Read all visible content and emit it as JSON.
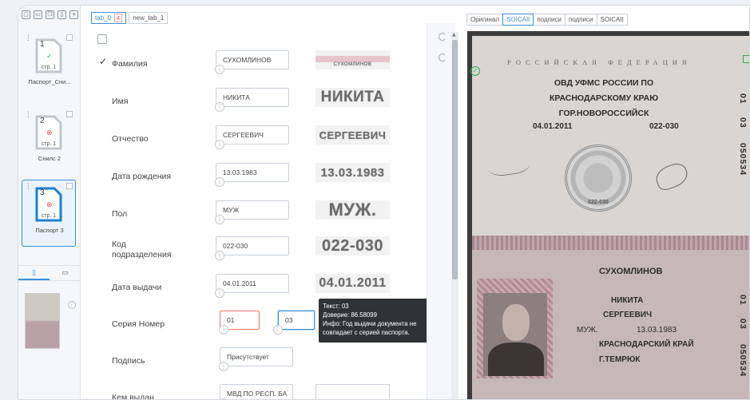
{
  "thumbs": {
    "docs": [
      {
        "num": "1",
        "status_icon": "✓",
        "status_color": "#2bb24c",
        "page": "стр. 1",
        "name": "Паспорт_Сни..."
      },
      {
        "num": "2",
        "status_icon": "⊗",
        "status_color": "#d9534f",
        "page": "стр. 1",
        "name": "Снилс 2"
      },
      {
        "num": "3",
        "status_icon": "⊗",
        "status_color": "#d9534f",
        "page": "стр. 1",
        "name": "Паспорт 3"
      }
    ]
  },
  "tabs": [
    {
      "label": "tab_0",
      "count": "4"
    },
    {
      "label": "new_tab_1"
    }
  ],
  "fields": [
    {
      "label": "Фамилия",
      "value": "СУХОМЛИНОВ",
      "crop_text": "СУХОМЛИНОВ",
      "checked": true
    },
    {
      "label": "Имя",
      "value": "НИКИТА",
      "crop_text": "НИКИТА"
    },
    {
      "label": "Отчество",
      "value": "СЕРГЕЕВИЧ",
      "crop_text": "СЕРГЕЕВИЧ"
    },
    {
      "label": "Дата рождения",
      "value": "13.03.1983",
      "crop_text": "13.03.1983"
    },
    {
      "label": "Пол",
      "value": "МУЖ",
      "crop_text": "МУЖ."
    },
    {
      "label": "Код подразделения",
      "value": "022-030",
      "crop_text": "022-030"
    },
    {
      "label": "Дата выдачи",
      "value": "04.01.2011",
      "crop_text": "04.01.2011"
    },
    {
      "label": "Серия Номер",
      "value": "01",
      "value2": "03"
    },
    {
      "label": "Подпись",
      "value": "Присутствует"
    },
    {
      "label": "Кем выдан",
      "value": "МВД ПО РЕСП. БА"
    }
  ],
  "tooltip": {
    "text": "Текст: 03",
    "confidence": "Доверие: 86.58099",
    "info": "Инфо: Год выдачи документа не совпадает с серией паспорта."
  },
  "viewer": {
    "tabs": [
      "Оригинал",
      "SOICAII",
      "подписи",
      "подписи",
      "SOICAII"
    ],
    "active_tab": 1
  },
  "passport": {
    "title": "РОССИЙСКАЯ ФЕДЕРАЦИЯ",
    "issuer": "ОВД УФМС РОССИИ ПО КРАСНОДАРСКОМУ КРАЮ ГОР.НОВОРОССИЙСК",
    "issue_date": "04.01.2011",
    "code": "022-030",
    "series_top": "01",
    "series_mid": "03",
    "number": "050534",
    "seal_code": "022-030",
    "surname": "СУХОМЛИНОВ",
    "name": "НИКИТА",
    "patronymic": "СЕРГЕЕВИЧ",
    "sex": "МУЖ.",
    "birth_date": "13.03.1983",
    "birth_place_1": "КРАСНОДАРСКИЙ КРАЙ",
    "birth_place_2": "Г.ТЕМРЮК"
  },
  "colors": {
    "accent": "#3b8fd9",
    "error": "#e8745f",
    "ok": "#2bb24c"
  }
}
